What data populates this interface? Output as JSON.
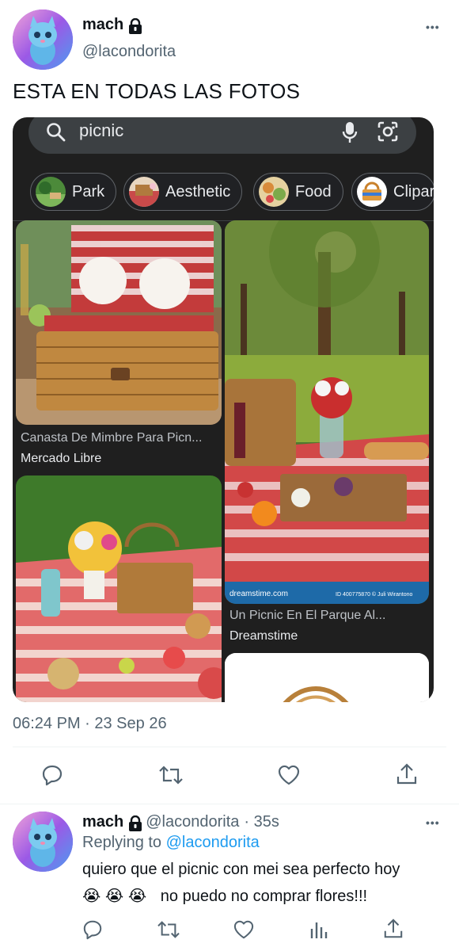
{
  "tweet": {
    "author_name": "mach",
    "author_handle": "@lacondorita",
    "text": "ESTA EN TODAS LAS FOTOS",
    "timestamp": "06:24 PM · 23 Sep 26"
  },
  "embedded_search": {
    "query": "picnic",
    "chips": [
      {
        "label": "Park",
        "icon": "park-thumb"
      },
      {
        "label": "Aesthetic",
        "icon": "aesthetic-thumb"
      },
      {
        "label": "Food",
        "icon": "food-thumb"
      },
      {
        "label": "Clipar",
        "icon": "clipart-thumb"
      }
    ],
    "results": [
      {
        "title": "Canasta De Mimbre Para Picn...",
        "source": "Mercado Libre"
      },
      {
        "title": "Un Picnic En El Parque Al...",
        "source": "Dreamstime"
      }
    ],
    "watermark": "dreamstime.com",
    "image_id": "ID 400775870 © Juli Wirantono"
  },
  "reply": {
    "author_name": "mach",
    "author_handle": "@lacondorita",
    "age": "· 35s",
    "replying_label": "Replying to",
    "replying_handle": "@lacondorita",
    "line1": "quiero que el picnic con mei sea perfecto hoy",
    "emojis": "😭 😭 😭",
    "line2": "no puedo no comprar flores!!!"
  },
  "more_label": "•••",
  "colors": {
    "text": "#0f1419",
    "muted": "#536471",
    "link": "#1d9bf0",
    "embed_bg": "#1f1f1f"
  }
}
